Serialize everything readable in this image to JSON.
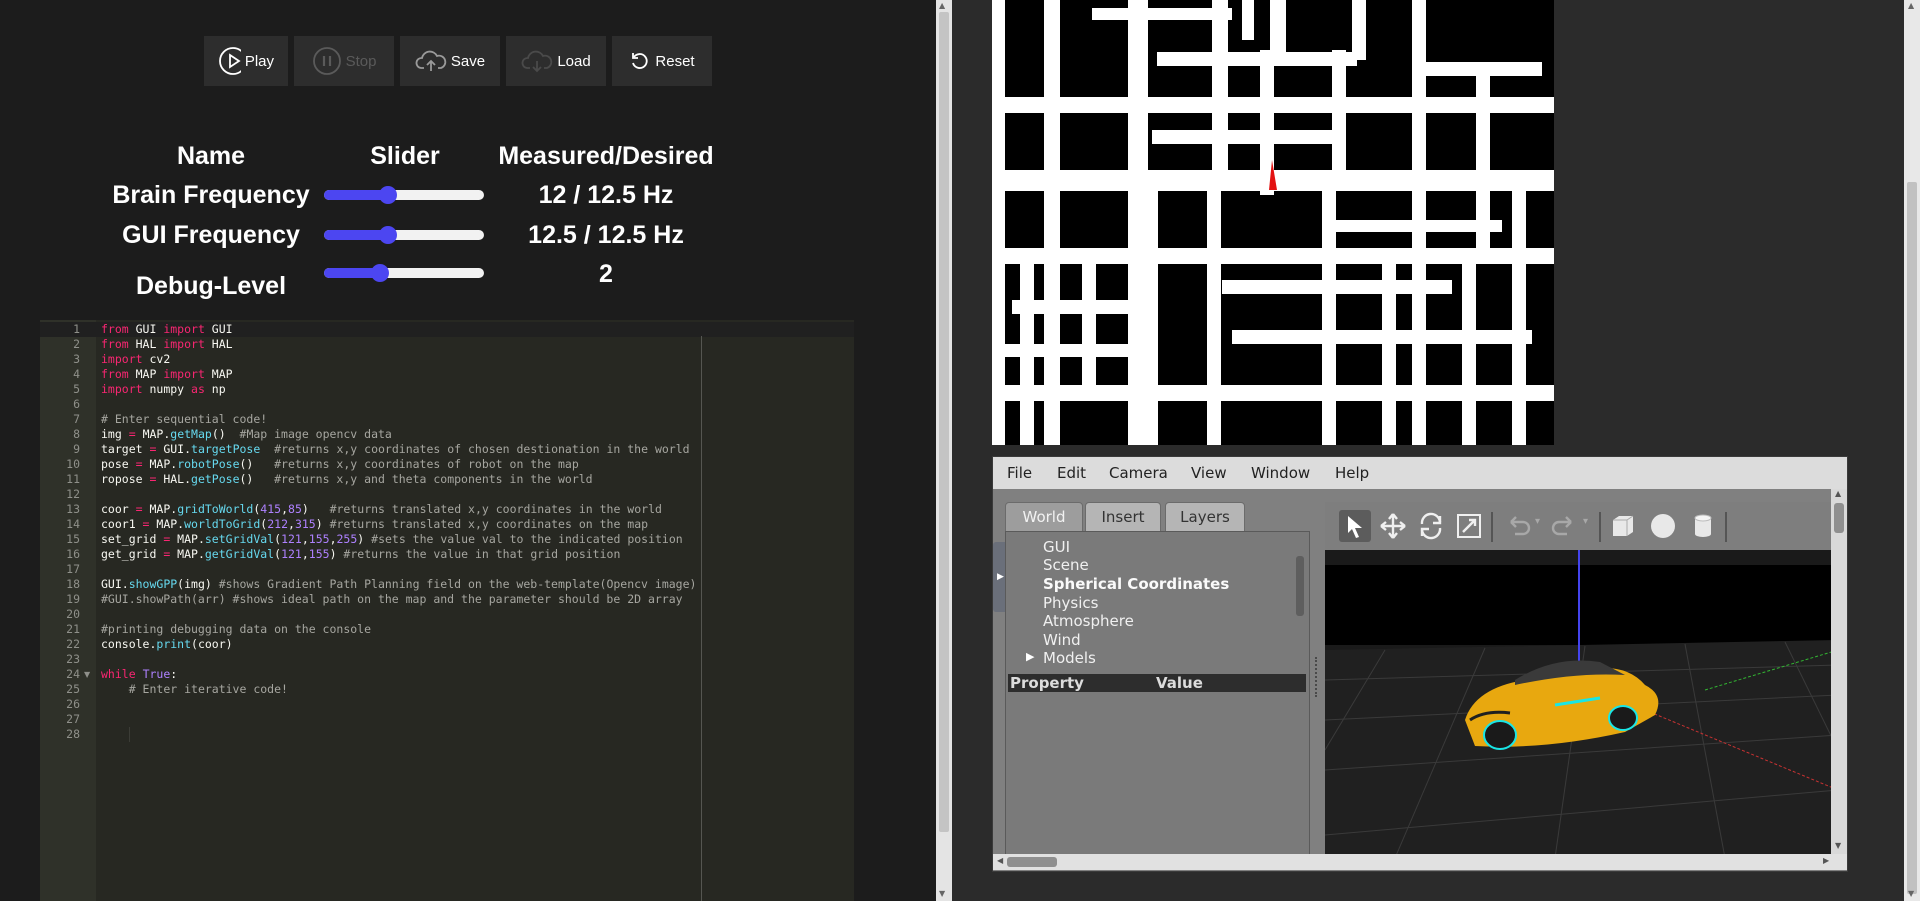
{
  "toolbar": {
    "buttons": [
      {
        "label": "Play",
        "icon": "play-icon",
        "enabled": true
      },
      {
        "label": "Stop",
        "icon": "pause-icon",
        "enabled": false
      },
      {
        "label": "Save",
        "icon": "cloud-upload-icon",
        "enabled": true
      },
      {
        "label": "Load",
        "icon": "cloud-download-icon",
        "enabled": true
      },
      {
        "label": "Reset",
        "icon": "reset-icon",
        "enabled": true
      }
    ]
  },
  "frequency_table": {
    "headers": [
      "Name",
      "Slider",
      "Measured/Desired"
    ],
    "rows": [
      {
        "name": "Brain Frequency",
        "value": "12 / 12.5 Hz",
        "slider_fraction": 0.4
      },
      {
        "name": "GUI Frequency",
        "value": "12.5 / 12.5 Hz",
        "slider_fraction": 0.4
      },
      {
        "name": "Debug-Level",
        "value": "2",
        "slider_fraction": 0.35
      }
    ]
  },
  "editor": {
    "theme": "monokai",
    "line_numbers": [
      "1",
      "2",
      "3",
      "4",
      "5",
      "6",
      "7",
      "8",
      "9",
      "10",
      "11",
      "12",
      "13",
      "14",
      "15",
      "16",
      "17",
      "18",
      "19",
      "20",
      "21",
      "22",
      "23",
      "24",
      "25",
      "26",
      "27",
      "28"
    ],
    "lines": [
      "from GUI import GUI",
      "from HAL import HAL",
      "import cv2",
      "from MAP import MAP",
      "import numpy as np",
      "",
      "# Enter sequential code!",
      "img = MAP.getMap()  #Map image opencv data",
      "target = GUI.targetPose  #returns x,y coordinates of chosen destionation in the world",
      "pose = MAP.robotPose()   #returns x,y coordinates of robot on the map",
      "ropose = HAL.getPose()   #returns x,y and theta components in the world",
      "",
      "coor = MAP.gridToWorld(415,85)   #returns translated x,y coordinates in the world",
      "coor1 = MAP.worldToGrid(212,315) #returns translated x,y coordinates on the map",
      "set_grid = MAP.setGridVal(121,155,255) #sets the value val to the indicated position",
      "get_grid = MAP.getGridVal(121,155) #returns the value in that grid position",
      "",
      "GUI.showGPP(img) #shows Gradient Path Planning field on the web-template(Opencv image)",
      "#GUI.showPath(arr) #shows ideal path on the map and the parameter should be 2D array",
      "",
      "#printing debugging data on the console",
      "console.print(coor)",
      "",
      "while True:",
      "    # Enter iterative code!",
      "",
      "",
      ""
    ]
  },
  "gazebo": {
    "menu": [
      "File",
      "Edit",
      "Camera",
      "View",
      "Window",
      "Help"
    ],
    "tabs": [
      "World",
      "Insert",
      "Layers"
    ],
    "active_tab": "World",
    "tree_items": [
      "GUI",
      "Scene",
      "Spherical Coordinates",
      "Physics",
      "Atmosphere",
      "Wind",
      "Models"
    ],
    "property_headers": [
      "Property",
      "Value"
    ],
    "toolbar_icons": [
      "select-arrow-icon",
      "translate-icon",
      "rotate-icon",
      "scale-icon",
      "undo-icon",
      "redo-icon",
      "box-shape-icon",
      "sphere-shape-icon",
      "cylinder-shape-icon"
    ]
  },
  "colors": {
    "slider_accent": "#4c46f1",
    "marker": "#e31212",
    "car_body": "#e8a80f",
    "car_glow": "#19e6e6"
  }
}
